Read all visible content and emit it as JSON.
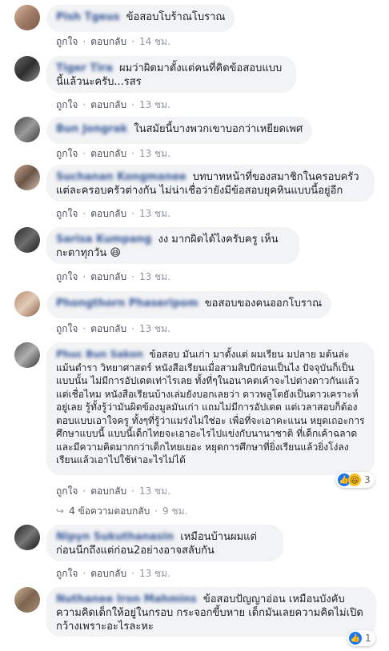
{
  "actions": {
    "like": "ถูกใจ",
    "reply": "ตอบกลับ"
  },
  "comments": [
    {
      "name": "Pish Tgeus",
      "text": "ข้อสอบโบร้าณโบราณ",
      "time": "14 ชม."
    },
    {
      "name": "Tiger Tira",
      "text": "ผมว่าผิดมาตั้งแต่คนที่คิดข้อสอบแบบนี้แล้วนะครับ...รสร",
      "time": "13 ชม."
    },
    {
      "name": "Bun Jongrak",
      "text": "ในสมัยนี้บางพวกเขาบอกว่าเหยียดเพศ",
      "time": "13 ชม."
    },
    {
      "name": "Suchanan Kongmanee",
      "text": "บทบาทหน้าที่ของสมาชิกในครอบครัว แต่ละครอบครัวต่างกัน ไม่น่าเชื่อว่ายังมีข้อสอบยุคหินแบบนี้อยู่อีก",
      "time": "13 ชม."
    },
    {
      "name": "Sarisa Kumpang",
      "text": "งง มากผิดได้ไงครับครู เห็นกะตาทุกวัน 😆",
      "time": "13 ชม."
    },
    {
      "name": "Phongthorn Phaseripom",
      "text": "ขอสอบของคนออกโบราณ",
      "time": "13 ชม."
    },
    {
      "name": "Phuc Bun Sakon",
      "text": "ข้อสอบ มันเก่า มาตั้งแต่ ผมเรียน มปลาย มต้นล่ะ แม้นตำรา วิทยาศาสตร์ หนังสือเรียนเมื่อสามสิบปีก่อนเป็นไง ปัจจุบันก็เป็นแบบนั้น ไม่มีการอัปเดตเท่าไรเลย ทั้งที่ๆในอนาคตเค้าจะไปต่างดาวกันแล้ว แต่เชื่อไหม หนังสือเรียนบ้างเล่มยังบอกเลยว่า ดาวพลูโตยังเป็นดาวเคราะห์อยู่เลย รู้ทั้งรู้ว่ามันผิดข้องมูลมันเก่า แถมไม่มีการอัปเดต แต่เวลาสอบก็ต้องตอบแบบเอาใจครู ทั้งๆที่รู้ว่าแมร่งไม่ใช่อะ เพื่อที่จะเอาคะแนน หยุดเถอะการศึกษาแบบนี้ แบบนี้เด็กไทยจะเอาอะไรไปแข่งกับนานาชาติ ที่เด็กเค้าฉลาดและมีความคิดมากกว่าเด็กไทยเยอะ หยุดการศึกษาที่ยิ่งเรียนแล้วยิ่งโง่ลง เรียนแล้วเอาไปใช้ห่าอะไรไม่ได้",
      "time": "13 ชม.",
      "reactions": "3"
    },
    {
      "name": "Nipyn Sukuthanasin",
      "text": "เหมือนบ้านผมแต่ก่อนนีกถึงแต่ก่อน2อย่างอาจสลับกัน",
      "time": "13 ชม."
    },
    {
      "name": "Nuthanee Iron Mahmins",
      "text": "ข้อสอบปัญญาอ่อน เหมือนบังคับความคิดเด็กให้อยู่ในกรอบ กระจอกขี้บหาย เด็กมันเลยความคิดไม่เปิดกว้างเพราะอะไรละหะ",
      "time": "",
      "reactions": "1"
    }
  ],
  "replies_link": "4 ข้อความตอบกลับ",
  "replies_time": "9 ชม."
}
